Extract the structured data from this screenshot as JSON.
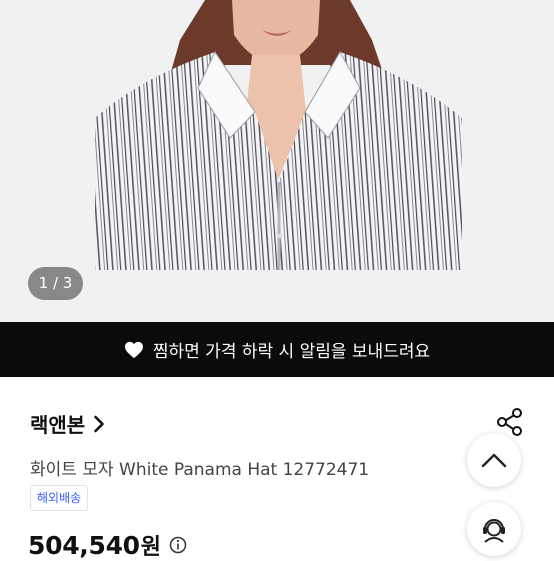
{
  "gallery": {
    "page_indicator": "1 / 3"
  },
  "wish_banner": {
    "text": "찜하면 가격 하락 시 알림을 보내드려요"
  },
  "product": {
    "shop_name": "랙앤본",
    "title": "화이트 모자 White Panama Hat 12772471",
    "badge": "해외배송",
    "price": "504,540",
    "price_unit": "원"
  },
  "icons": {
    "banner": "heart-icon",
    "shop": "chevron-right-icon",
    "price": "info-icon",
    "share": "share-icon",
    "scroll_top": "chevron-up-icon",
    "support": "customer-support-icon"
  },
  "colors": {
    "banner_bg": "#0b0b0b",
    "badge_text": "#3b5bff"
  }
}
